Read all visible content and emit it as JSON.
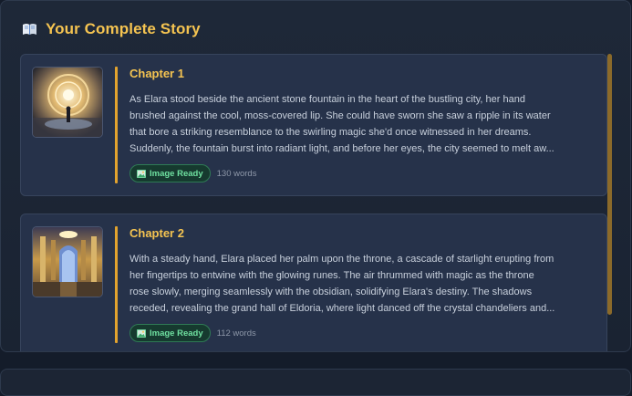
{
  "header": {
    "icon": "open-book-icon",
    "title": "Your Complete Story"
  },
  "chapters": [
    {
      "title": "Chapter 1",
      "lines": [
        "As Elara stood beside the ancient stone fountain in the heart of the bustling city, her hand",
        "brushed against the cool, moss-covered lip. She could have sworn she saw a ripple in its water",
        "that bore a striking resemblance to the swirling magic she'd once witnessed in her dreams.",
        "Suddenly, the fountain burst into radiant light, and before her eyes, the city seemed to melt aw..."
      ],
      "badge": "Image Ready",
      "words": "130 words"
    },
    {
      "title": "Chapter 2",
      "lines": [
        "With a steady hand, Elara placed her palm upon the throne, a cascade of starlight erupting from",
        "her fingertips to entwine with the glowing runes. The air thrummed with magic as the throne",
        "rose slowly, merging seamlessly with the obsidian, solidifying Elara's destiny. The shadows",
        "receded, revealing the grand hall of Eldoria, where light danced off the crystal chandeliers and..."
      ],
      "badge": "Image Ready",
      "words": "112 words"
    }
  ],
  "colors": {
    "accent": "#f5c451",
    "badge_text": "#6fe0a0",
    "bar": "#e2a32e"
  }
}
